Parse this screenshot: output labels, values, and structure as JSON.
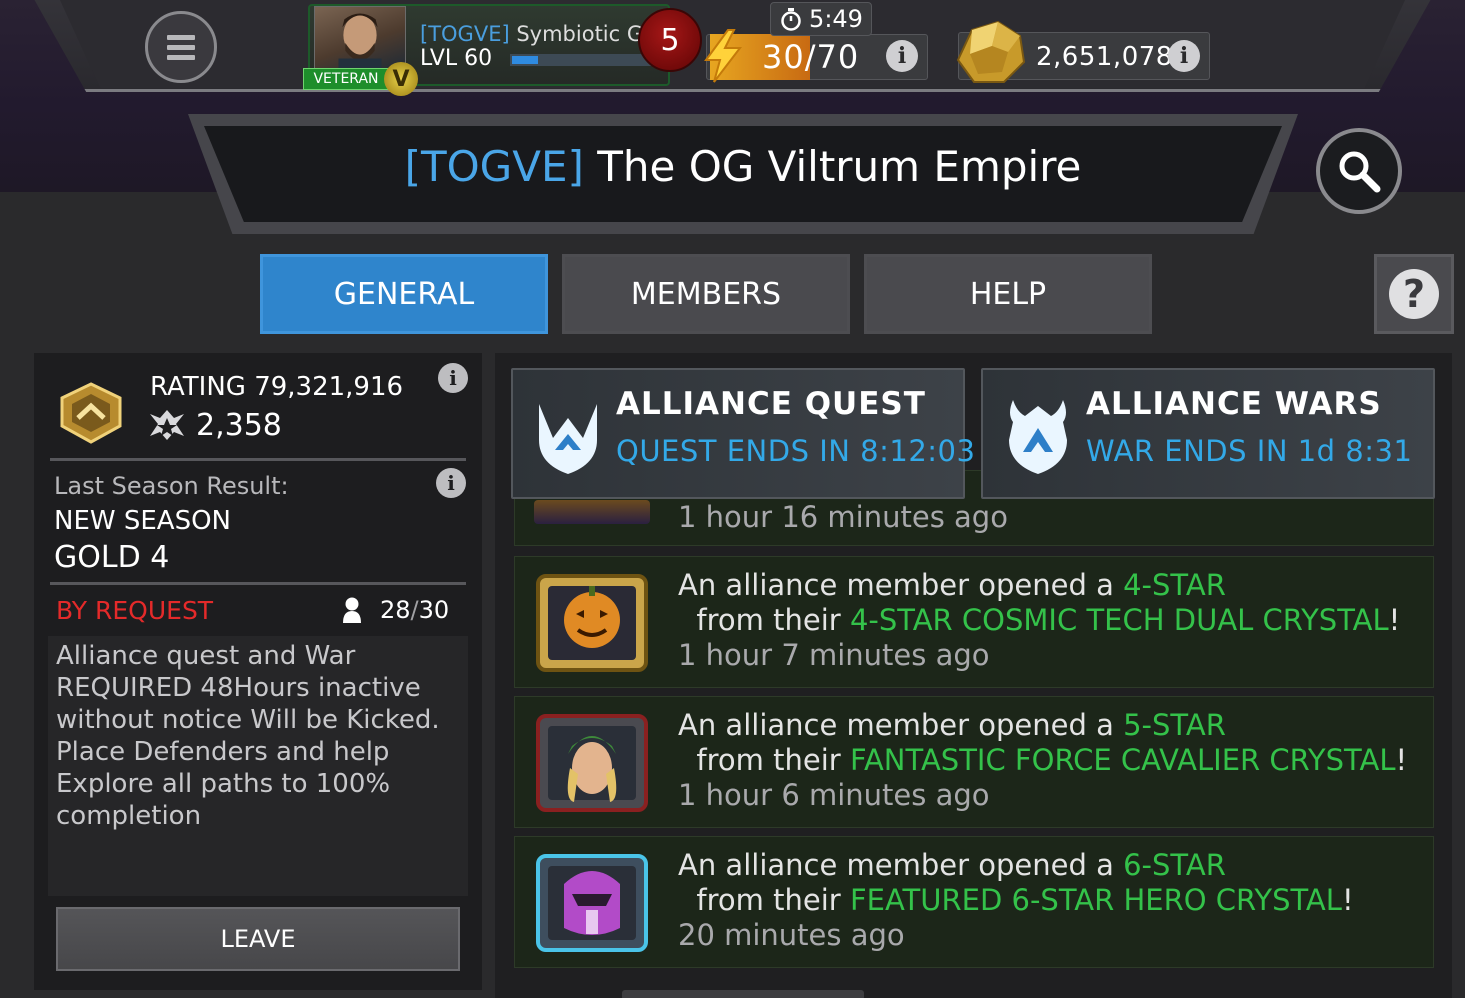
{
  "header": {
    "player": {
      "tag": "[TOGVE]",
      "name": "Symbiotic Gus",
      "level_label": "LVL 60",
      "xp_progress": 0.18,
      "badge": "VETERAN"
    },
    "notifications_count": "5",
    "energy": {
      "timer": "5:49",
      "current": "30",
      "separator": "/",
      "max": "70"
    },
    "gold": "2,651,078",
    "icons": [
      "menu-icon",
      "energy-bolt-icon",
      "stopwatch-icon",
      "gold-nugget-icon",
      "info-icon",
      "search-icon"
    ]
  },
  "alliance": {
    "tag": "[TOGVE]",
    "name": "The OG Viltrum Empire"
  },
  "tabs": {
    "general": "GENERAL",
    "members": "MEMBERS",
    "help": "HELP"
  },
  "info_panel": {
    "rating_label": "RATING 79,321,916",
    "trophies": "2,358",
    "last_season_label": "Last Season Result:",
    "last_season_value": "NEW SEASON",
    "rank": "GOLD 4",
    "join_type": "BY REQUEST",
    "member_count": "28",
    "member_sep": "/",
    "member_max": "30",
    "description": "Alliance quest and War REQUIRED 48Hours inactive without notice Will be Kicked. Place Defenders and help Explore all paths to 100% completion",
    "leave_label": "LEAVE"
  },
  "modes": {
    "quest": {
      "title": "ALLIANCE QUEST",
      "status": "QUEST ENDS IN 8:12:03"
    },
    "wars": {
      "title": "ALLIANCE WARS",
      "status": "WAR ENDS IN 1d 8:31"
    }
  },
  "feed": {
    "partial_time": "1 hour 16 minutes ago",
    "items": [
      {
        "prefix": "An alliance member opened a ",
        "rarity": "4-STAR",
        "middle": "  from their ",
        "crystal": "4-STAR COSMIC TECH DUAL CRYSTAL",
        "suffix": "!",
        "time": "1 hour 7 minutes ago"
      },
      {
        "prefix": "An alliance member opened a ",
        "rarity": "5-STAR",
        "middle": "  from their ",
        "crystal": "FANTASTIC FORCE CAVALIER CRYSTAL",
        "suffix": "!",
        "time": "1 hour 6 minutes ago"
      },
      {
        "prefix": "An alliance member opened a ",
        "rarity": "6-STAR",
        "middle": "  from their ",
        "crystal": "FEATURED 6-STAR HERO CRYSTAL",
        "suffix": "!",
        "time": "20 minutes ago"
      }
    ]
  },
  "colors": {
    "accent_blue": "#2f85cc",
    "highlight_green": "#34c24a",
    "request_red": "#e42a2a",
    "quest_status_blue": "#33a9e8"
  }
}
